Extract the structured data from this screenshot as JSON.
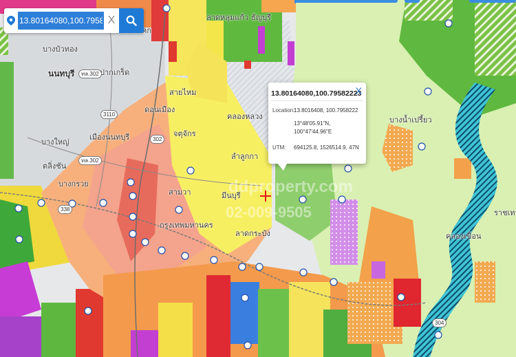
{
  "search": {
    "value": "13.80164080,100.79582223",
    "clear_symbol": "X"
  },
  "popup": {
    "title": "13.80164080,100.79582223",
    "close_symbol": "X",
    "location_label": "Location:",
    "location_decimal": "13.8016408, 100.7958222",
    "location_lat_dms": "13°48'05.91\"N,",
    "location_lon_dms": "100°47'44.96\"E",
    "utm_label": "UTM:",
    "utm_value": "694125.8, 1526514.9, 47N"
  },
  "place_labels": {
    "nonthaburi": "นนทบุรี",
    "pak_kret": "ปากเกร็ด",
    "bang_yai": "บางใหญ่",
    "mueang_nonthaburi": "เมืองนนทบุรี",
    "bang_kruai": "บางกรวย",
    "lat_lum_kaeo": "ลาดหลุมแก้ว",
    "khlong_luang": "คลองหลวง",
    "thanyaburi": "ธัญบุรี",
    "bang_nam_priao": "บางน้ำเปรี้ยว",
    "khlong_khuean": "คลองเขื่อน",
    "bangkok": "กรุงเทพมหานคร",
    "lat_krabang": "ลาดกระบัง",
    "min_buri": "มีนบุรี",
    "sam_wa": "สามวา",
    "sai_mai": "สายไหม",
    "don_mueang": "ดอนเมือง",
    "chatuchak": "จตุจักร",
    "lam_luk_ka": "ลำลูกกา",
    "bang_bua_thong": "บางบัวทอง",
    "taling_chan": "ตลิ่งชัน",
    "sam_khok": "สามโคก",
    "ratchathewa": "ราชเทวา"
  },
  "route_shields": [
    "ทล.302",
    "3110",
    "ทล.302",
    "338",
    "302",
    "304"
  ],
  "watermark": {
    "line1": "ddproperty.com",
    "line2": "02-009-9505"
  },
  "colors": {
    "search_button": "#1f7ad6",
    "popup_close": "#2a75c9",
    "marker": "#e21c1c"
  }
}
